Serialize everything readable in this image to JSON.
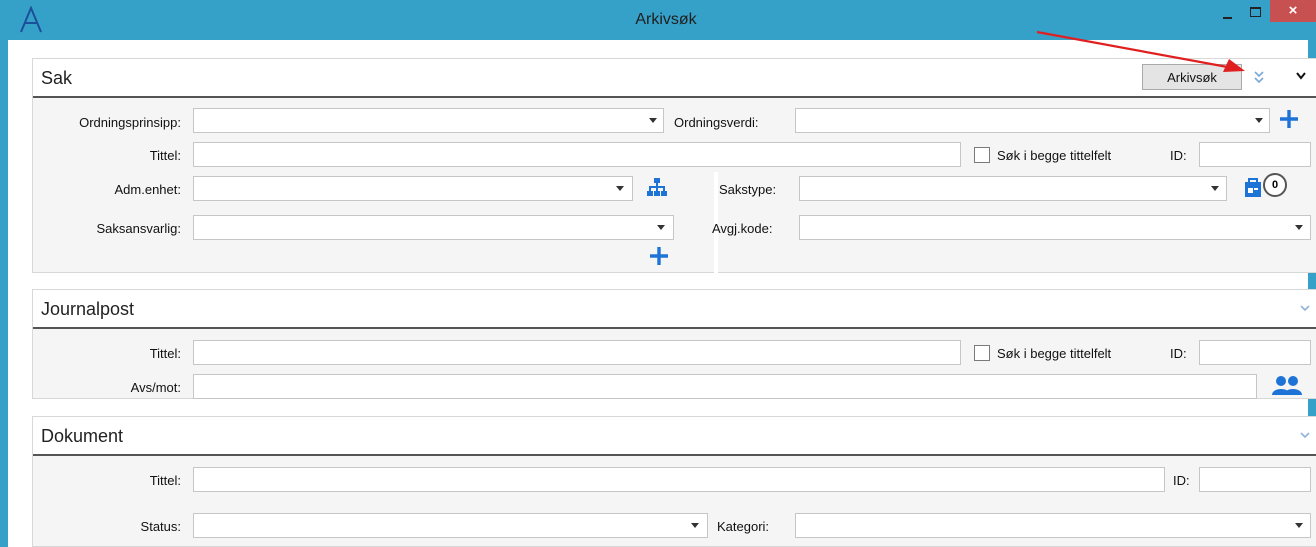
{
  "window": {
    "title": "Arkivsøk",
    "close_glyph": "×"
  },
  "sak": {
    "title": "Sak",
    "search_button": "Arkivsøk",
    "ordningsprinsipp_label": "Ordningsprinsipp:",
    "ordningsverdi_label": "Ordningsverdi:",
    "tittel_label": "Tittel:",
    "sok_begge_label": "Søk i begge tittelfelt",
    "id_label": "ID:",
    "adm_enhet_label": "Adm.enhet:",
    "sakstype_label": "Sakstype:",
    "saksansvarlig_label": "Saksansvarlig:",
    "avgj_kode_label": "Avgj.kode:",
    "count_badge": "0"
  },
  "journalpost": {
    "title": "Journalpost",
    "tittel_label": "Tittel:",
    "sok_begge_label": "Søk i begge tittelfelt",
    "id_label": "ID:",
    "avs_mot_label": "Avs/mot:"
  },
  "dokument": {
    "title": "Dokument",
    "tittel_label": "Tittel:",
    "id_label": "ID:",
    "status_label": "Status:",
    "kategori_label": "Kategori:"
  },
  "colors": {
    "titlebar": "#35a1c9",
    "accent_blue": "#1e73d7",
    "close_red": "#c75050",
    "annotation_red": "#e02020"
  },
  "icons": [
    "app-logo-icon",
    "minimize-icon",
    "maximize-icon",
    "close-icon",
    "collapse-all-icon",
    "chevron-down-icon",
    "add-icon",
    "org-tree-icon",
    "case-type-icon",
    "persons-icon",
    "dropdown-arrow-icon"
  ]
}
